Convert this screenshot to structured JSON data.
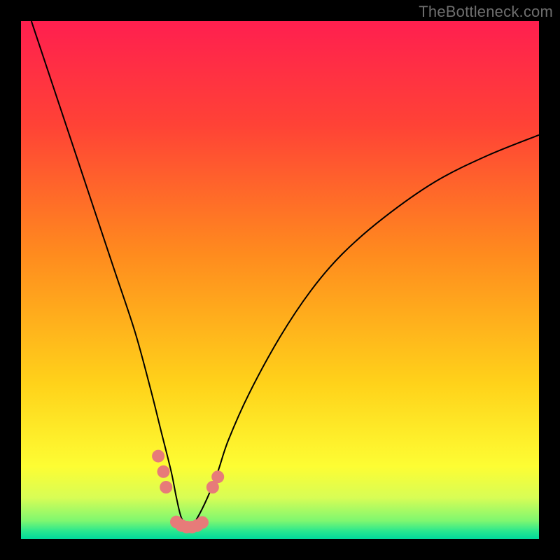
{
  "attribution": "TheBottleneck.com",
  "chart_data": {
    "type": "line",
    "title": "",
    "xlabel": "",
    "ylabel": "",
    "xlim": [
      0,
      100
    ],
    "ylim": [
      0,
      100
    ],
    "grid": false,
    "series": [
      {
        "name": "bottleneck-curve",
        "color": "#000000",
        "x": [
          2,
          6,
          10,
          14,
          18,
          22,
          25,
          27,
          29,
          30,
          31,
          32.5,
          34,
          36,
          38,
          40,
          44,
          50,
          56,
          62,
          70,
          80,
          90,
          100
        ],
        "y": [
          100,
          88,
          76,
          64,
          52,
          40,
          29,
          21,
          13,
          8,
          4,
          2,
          4,
          8,
          13,
          19,
          28,
          39,
          48,
          55,
          62,
          69,
          74,
          78
        ]
      }
    ],
    "markers": {
      "name": "highlight-dots",
      "color": "#e77b79",
      "points": [
        {
          "x": 26.5,
          "y": 16
        },
        {
          "x": 27.5,
          "y": 13
        },
        {
          "x": 28.0,
          "y": 10
        },
        {
          "x": 30.0,
          "y": 3.3
        },
        {
          "x": 31.0,
          "y": 2.6
        },
        {
          "x": 32.0,
          "y": 2.3
        },
        {
          "x": 33.0,
          "y": 2.3
        },
        {
          "x": 34.0,
          "y": 2.6
        },
        {
          "x": 35.0,
          "y": 3.2
        },
        {
          "x": 37.0,
          "y": 10
        },
        {
          "x": 38.0,
          "y": 12
        }
      ]
    },
    "background_gradient": {
      "stops": [
        {
          "offset": 0.0,
          "color": "#ff1f4f"
        },
        {
          "offset": 0.2,
          "color": "#ff4236"
        },
        {
          "offset": 0.45,
          "color": "#ff8b1e"
        },
        {
          "offset": 0.7,
          "color": "#ffd21a"
        },
        {
          "offset": 0.86,
          "color": "#fdfd33"
        },
        {
          "offset": 0.92,
          "color": "#d8fd55"
        },
        {
          "offset": 0.965,
          "color": "#7ef770"
        },
        {
          "offset": 0.985,
          "color": "#28e78f"
        },
        {
          "offset": 1.0,
          "color": "#00d99b"
        }
      ]
    }
  }
}
